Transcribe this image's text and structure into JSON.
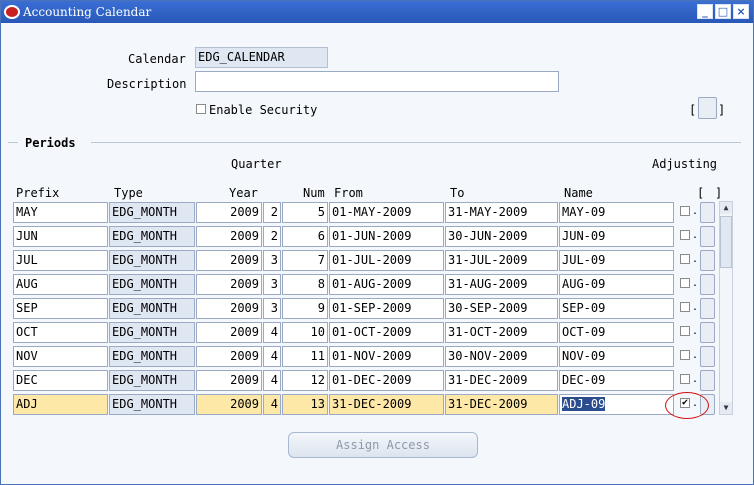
{
  "window": {
    "title": "Accounting Calendar",
    "buttons": [
      "minimize",
      "maximize",
      "close"
    ]
  },
  "header": {
    "calendar_label": "Calendar",
    "calendar_value": "EDG_CALENDAR",
    "description_label": "Description",
    "description_value": "",
    "enable_security_label": "Enable Security",
    "enable_security_checked": false,
    "flex_open": "[",
    "flex_close": "]"
  },
  "periods": {
    "section_label": "Periods",
    "col_headers": {
      "quarter": "Quarter",
      "adjusting": "Adjusting",
      "prefix": "Prefix",
      "type": "Type",
      "year": "Year",
      "num": "Num",
      "from": "From",
      "to": "To",
      "name": "Name",
      "bracket_open": "[",
      "bracket_close": "]"
    },
    "rows": [
      {
        "prefix": "MAY",
        "type": "EDG_MONTH",
        "year": "2009",
        "quarter": "2",
        "num": "5",
        "from": "01-MAY-2009",
        "to": "31-MAY-2009",
        "name": "MAY-09",
        "adjusting": false
      },
      {
        "prefix": "JUN",
        "type": "EDG_MONTH",
        "year": "2009",
        "quarter": "2",
        "num": "6",
        "from": "01-JUN-2009",
        "to": "30-JUN-2009",
        "name": "JUN-09",
        "adjusting": false
      },
      {
        "prefix": "JUL",
        "type": "EDG_MONTH",
        "year": "2009",
        "quarter": "3",
        "num": "7",
        "from": "01-JUL-2009",
        "to": "31-JUL-2009",
        "name": "JUL-09",
        "adjusting": false
      },
      {
        "prefix": "AUG",
        "type": "EDG_MONTH",
        "year": "2009",
        "quarter": "3",
        "num": "8",
        "from": "01-AUG-2009",
        "to": "31-AUG-2009",
        "name": "AUG-09",
        "adjusting": false
      },
      {
        "prefix": "SEP",
        "type": "EDG_MONTH",
        "year": "2009",
        "quarter": "3",
        "num": "9",
        "from": "01-SEP-2009",
        "to": "30-SEP-2009",
        "name": "SEP-09",
        "adjusting": false
      },
      {
        "prefix": "OCT",
        "type": "EDG_MONTH",
        "year": "2009",
        "quarter": "4",
        "num": "10",
        "from": "01-OCT-2009",
        "to": "31-OCT-2009",
        "name": "OCT-09",
        "adjusting": false
      },
      {
        "prefix": "NOV",
        "type": "EDG_MONTH",
        "year": "2009",
        "quarter": "4",
        "num": "11",
        "from": "01-NOV-2009",
        "to": "30-NOV-2009",
        "name": "NOV-09",
        "adjusting": false
      },
      {
        "prefix": "DEC",
        "type": "EDG_MONTH",
        "year": "2009",
        "quarter": "4",
        "num": "12",
        "from": "01-DEC-2009",
        "to": "31-DEC-2009",
        "name": "DEC-09",
        "adjusting": false
      },
      {
        "prefix": "ADJ",
        "type": "EDG_MONTH",
        "year": "2009",
        "quarter": "4",
        "num": "13",
        "from": "31-DEC-2009",
        "to": "31-DEC-2009",
        "name": "ADJ-09",
        "adjusting": true
      }
    ],
    "selected_row_index": 8
  },
  "footer": {
    "assign_access_label": "Assign Access"
  },
  "colors": {
    "titlebar": "#2859b8",
    "selected_row": "#fde8a8",
    "highlight_ellipse": "#d01010"
  }
}
